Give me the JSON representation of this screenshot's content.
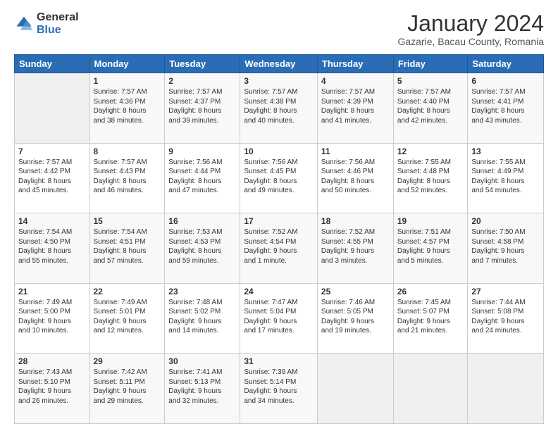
{
  "logo": {
    "general": "General",
    "blue": "Blue"
  },
  "header": {
    "title": "January 2024",
    "subtitle": "Gazarie, Bacau County, Romania"
  },
  "weekdays": [
    "Sunday",
    "Monday",
    "Tuesday",
    "Wednesday",
    "Thursday",
    "Friday",
    "Saturday"
  ],
  "weeks": [
    [
      {
        "day": "",
        "content": ""
      },
      {
        "day": "1",
        "content": "Sunrise: 7:57 AM\nSunset: 4:36 PM\nDaylight: 8 hours\nand 38 minutes."
      },
      {
        "day": "2",
        "content": "Sunrise: 7:57 AM\nSunset: 4:37 PM\nDaylight: 8 hours\nand 39 minutes."
      },
      {
        "day": "3",
        "content": "Sunrise: 7:57 AM\nSunset: 4:38 PM\nDaylight: 8 hours\nand 40 minutes."
      },
      {
        "day": "4",
        "content": "Sunrise: 7:57 AM\nSunset: 4:39 PM\nDaylight: 8 hours\nand 41 minutes."
      },
      {
        "day": "5",
        "content": "Sunrise: 7:57 AM\nSunset: 4:40 PM\nDaylight: 8 hours\nand 42 minutes."
      },
      {
        "day": "6",
        "content": "Sunrise: 7:57 AM\nSunset: 4:41 PM\nDaylight: 8 hours\nand 43 minutes."
      }
    ],
    [
      {
        "day": "7",
        "content": "Sunrise: 7:57 AM\nSunset: 4:42 PM\nDaylight: 8 hours\nand 45 minutes."
      },
      {
        "day": "8",
        "content": "Sunrise: 7:57 AM\nSunset: 4:43 PM\nDaylight: 8 hours\nand 46 minutes."
      },
      {
        "day": "9",
        "content": "Sunrise: 7:56 AM\nSunset: 4:44 PM\nDaylight: 8 hours\nand 47 minutes."
      },
      {
        "day": "10",
        "content": "Sunrise: 7:56 AM\nSunset: 4:45 PM\nDaylight: 8 hours\nand 49 minutes."
      },
      {
        "day": "11",
        "content": "Sunrise: 7:56 AM\nSunset: 4:46 PM\nDaylight: 8 hours\nand 50 minutes."
      },
      {
        "day": "12",
        "content": "Sunrise: 7:55 AM\nSunset: 4:48 PM\nDaylight: 8 hours\nand 52 minutes."
      },
      {
        "day": "13",
        "content": "Sunrise: 7:55 AM\nSunset: 4:49 PM\nDaylight: 8 hours\nand 54 minutes."
      }
    ],
    [
      {
        "day": "14",
        "content": "Sunrise: 7:54 AM\nSunset: 4:50 PM\nDaylight: 8 hours\nand 55 minutes."
      },
      {
        "day": "15",
        "content": "Sunrise: 7:54 AM\nSunset: 4:51 PM\nDaylight: 8 hours\nand 57 minutes."
      },
      {
        "day": "16",
        "content": "Sunrise: 7:53 AM\nSunset: 4:53 PM\nDaylight: 8 hours\nand 59 minutes."
      },
      {
        "day": "17",
        "content": "Sunrise: 7:52 AM\nSunset: 4:54 PM\nDaylight: 9 hours\nand 1 minute."
      },
      {
        "day": "18",
        "content": "Sunrise: 7:52 AM\nSunset: 4:55 PM\nDaylight: 9 hours\nand 3 minutes."
      },
      {
        "day": "19",
        "content": "Sunrise: 7:51 AM\nSunset: 4:57 PM\nDaylight: 9 hours\nand 5 minutes."
      },
      {
        "day": "20",
        "content": "Sunrise: 7:50 AM\nSunset: 4:58 PM\nDaylight: 9 hours\nand 7 minutes."
      }
    ],
    [
      {
        "day": "21",
        "content": "Sunrise: 7:49 AM\nSunset: 5:00 PM\nDaylight: 9 hours\nand 10 minutes."
      },
      {
        "day": "22",
        "content": "Sunrise: 7:49 AM\nSunset: 5:01 PM\nDaylight: 9 hours\nand 12 minutes."
      },
      {
        "day": "23",
        "content": "Sunrise: 7:48 AM\nSunset: 5:02 PM\nDaylight: 9 hours\nand 14 minutes."
      },
      {
        "day": "24",
        "content": "Sunrise: 7:47 AM\nSunset: 5:04 PM\nDaylight: 9 hours\nand 17 minutes."
      },
      {
        "day": "25",
        "content": "Sunrise: 7:46 AM\nSunset: 5:05 PM\nDaylight: 9 hours\nand 19 minutes."
      },
      {
        "day": "26",
        "content": "Sunrise: 7:45 AM\nSunset: 5:07 PM\nDaylight: 9 hours\nand 21 minutes."
      },
      {
        "day": "27",
        "content": "Sunrise: 7:44 AM\nSunset: 5:08 PM\nDaylight: 9 hours\nand 24 minutes."
      }
    ],
    [
      {
        "day": "28",
        "content": "Sunrise: 7:43 AM\nSunset: 5:10 PM\nDaylight: 9 hours\nand 26 minutes."
      },
      {
        "day": "29",
        "content": "Sunrise: 7:42 AM\nSunset: 5:11 PM\nDaylight: 9 hours\nand 29 minutes."
      },
      {
        "day": "30",
        "content": "Sunrise: 7:41 AM\nSunset: 5:13 PM\nDaylight: 9 hours\nand 32 minutes."
      },
      {
        "day": "31",
        "content": "Sunrise: 7:39 AM\nSunset: 5:14 PM\nDaylight: 9 hours\nand 34 minutes."
      },
      {
        "day": "",
        "content": ""
      },
      {
        "day": "",
        "content": ""
      },
      {
        "day": "",
        "content": ""
      }
    ]
  ]
}
